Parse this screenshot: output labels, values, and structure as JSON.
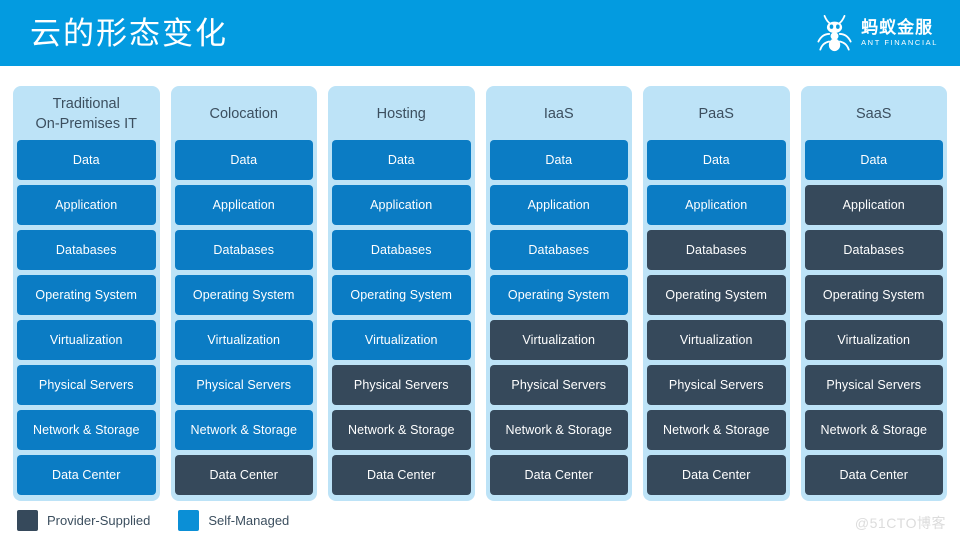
{
  "header": {
    "title": "云的形态变化",
    "background_color": "#039BE0",
    "brand": {
      "icon": "ant-logo-icon",
      "name_cn": "蚂蚁金服",
      "name_en": "ANT FINANCIAL"
    }
  },
  "colors": {
    "header_blue": "#039BE0",
    "card_background": "#BDE3F7",
    "self_managed": "#0B7CC4",
    "provider_supplied": "#36495B",
    "header_text": "#3C4F5F",
    "watermark": "#DCDCDC"
  },
  "layers": [
    "Data",
    "Application",
    "Databases",
    "Operating System",
    "Virtualization",
    "Physical Servers",
    "Network & Storage",
    "Data Center"
  ],
  "columns": [
    {
      "title": "Traditional\nOn-Premises IT",
      "title_lines": [
        "Traditional",
        "On-Premises IT"
      ],
      "rows": [
        {
          "label": "Data",
          "owner": "self"
        },
        {
          "label": "Application",
          "owner": "self"
        },
        {
          "label": "Databases",
          "owner": "self"
        },
        {
          "label": "Operating System",
          "owner": "self"
        },
        {
          "label": "Virtualization",
          "owner": "self"
        },
        {
          "label": "Physical Servers",
          "owner": "self"
        },
        {
          "label": "Network & Storage",
          "owner": "self"
        },
        {
          "label": "Data Center",
          "owner": "self"
        }
      ]
    },
    {
      "title": "Colocation",
      "title_lines": [
        "Colocation"
      ],
      "rows": [
        {
          "label": "Data",
          "owner": "self"
        },
        {
          "label": "Application",
          "owner": "self"
        },
        {
          "label": "Databases",
          "owner": "self"
        },
        {
          "label": "Operating System",
          "owner": "self"
        },
        {
          "label": "Virtualization",
          "owner": "self"
        },
        {
          "label": "Physical Servers",
          "owner": "self"
        },
        {
          "label": "Network & Storage",
          "owner": "self"
        },
        {
          "label": "Data Center",
          "owner": "provider"
        }
      ]
    },
    {
      "title": "Hosting",
      "title_lines": [
        "Hosting"
      ],
      "rows": [
        {
          "label": "Data",
          "owner": "self"
        },
        {
          "label": "Application",
          "owner": "self"
        },
        {
          "label": "Databases",
          "owner": "self"
        },
        {
          "label": "Operating System",
          "owner": "self"
        },
        {
          "label": "Virtualization",
          "owner": "self"
        },
        {
          "label": "Physical Servers",
          "owner": "provider"
        },
        {
          "label": "Network & Storage",
          "owner": "provider"
        },
        {
          "label": "Data Center",
          "owner": "provider"
        }
      ]
    },
    {
      "title": "IaaS",
      "title_lines": [
        "IaaS"
      ],
      "rows": [
        {
          "label": "Data",
          "owner": "self"
        },
        {
          "label": "Application",
          "owner": "self"
        },
        {
          "label": "Databases",
          "owner": "self"
        },
        {
          "label": "Operating System",
          "owner": "self"
        },
        {
          "label": "Virtualization",
          "owner": "provider"
        },
        {
          "label": "Physical Servers",
          "owner": "provider"
        },
        {
          "label": "Network & Storage",
          "owner": "provider"
        },
        {
          "label": "Data Center",
          "owner": "provider"
        }
      ]
    },
    {
      "title": "PaaS",
      "title_lines": [
        "PaaS"
      ],
      "rows": [
        {
          "label": "Data",
          "owner": "self"
        },
        {
          "label": "Application",
          "owner": "self"
        },
        {
          "label": "Databases",
          "owner": "provider"
        },
        {
          "label": "Operating System",
          "owner": "provider"
        },
        {
          "label": "Virtualization",
          "owner": "provider"
        },
        {
          "label": "Physical Servers",
          "owner": "provider"
        },
        {
          "label": "Network & Storage",
          "owner": "provider"
        },
        {
          "label": "Data Center",
          "owner": "provider"
        }
      ]
    },
    {
      "title": "SaaS",
      "title_lines": [
        "SaaS"
      ],
      "rows": [
        {
          "label": "Data",
          "owner": "self"
        },
        {
          "label": "Application",
          "owner": "provider"
        },
        {
          "label": "Databases",
          "owner": "provider"
        },
        {
          "label": "Operating System",
          "owner": "provider"
        },
        {
          "label": "Virtualization",
          "owner": "provider"
        },
        {
          "label": "Physical Servers",
          "owner": "provider"
        },
        {
          "label": "Network & Storage",
          "owner": "provider"
        },
        {
          "label": "Data Center",
          "owner": "provider"
        }
      ]
    }
  ],
  "legend": [
    {
      "label": "Provider-Supplied",
      "owner": "provider"
    },
    {
      "label": "Self-Managed",
      "owner": "self"
    }
  ],
  "watermark": "@51CTO博客"
}
